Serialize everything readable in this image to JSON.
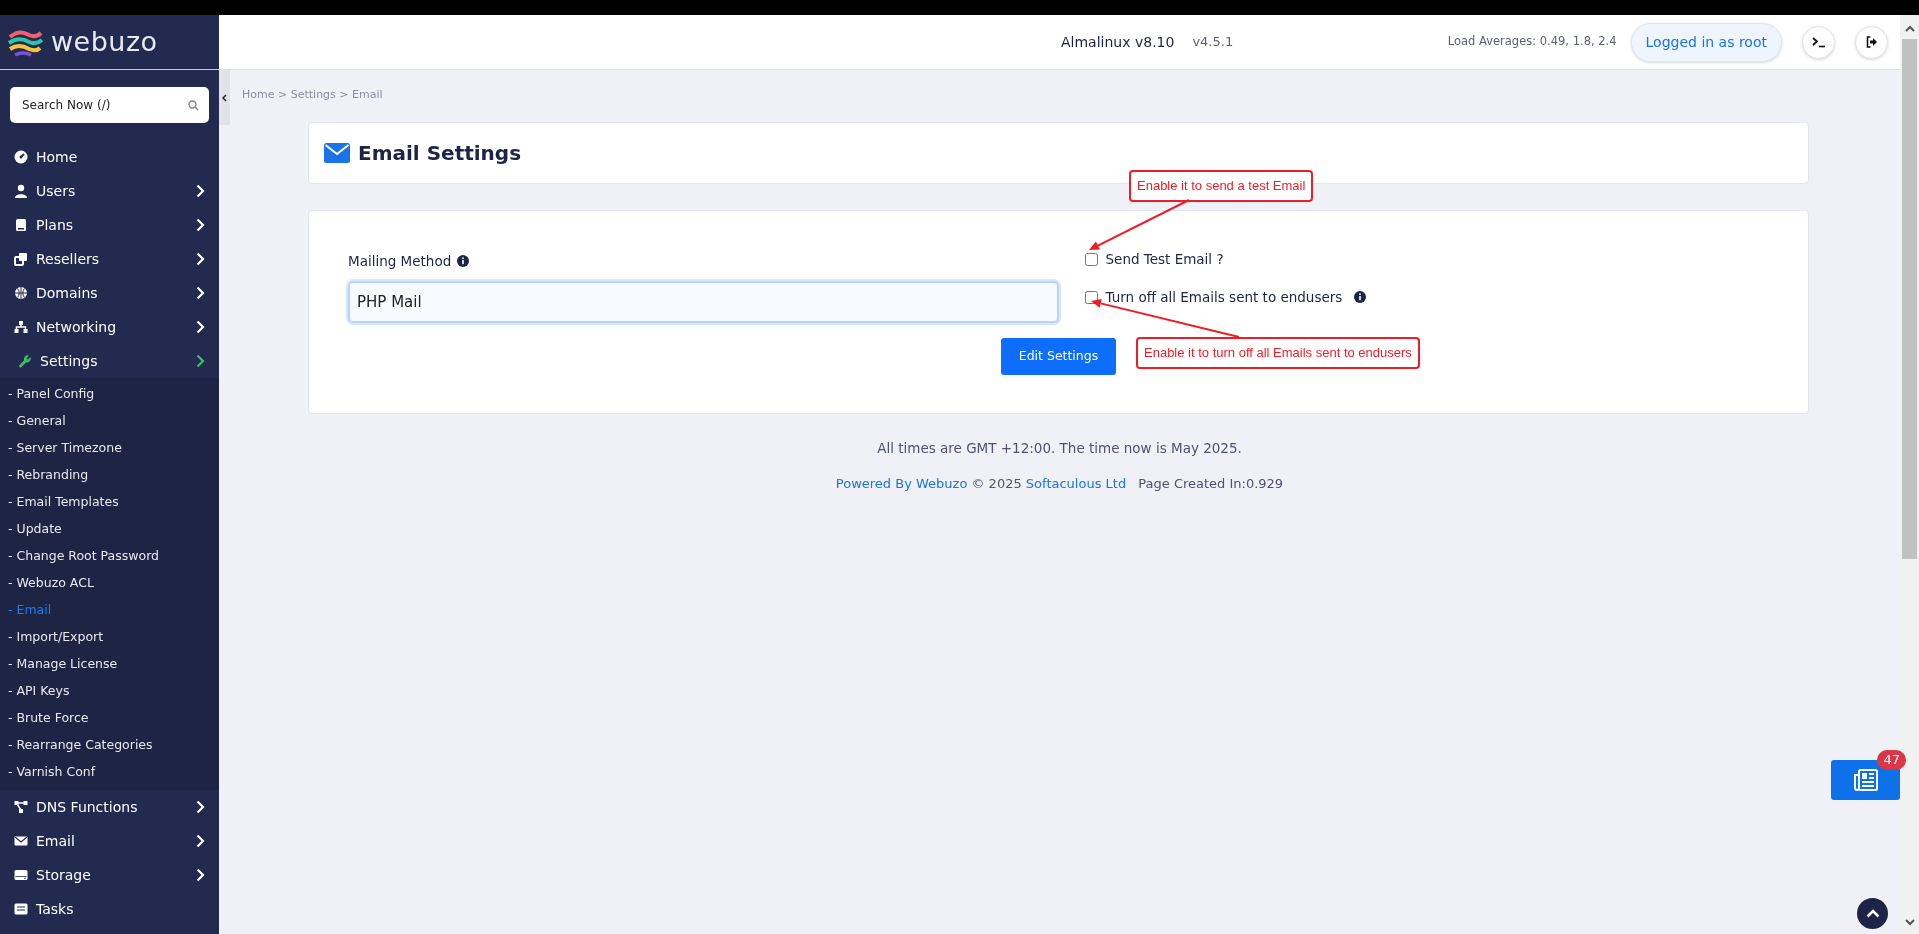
{
  "sidebar": {
    "logo": "webuzo",
    "search": {
      "placeholder": "Search Now (/)"
    },
    "items": [
      {
        "label": "Home",
        "has_submenu": false,
        "expanded": false
      },
      {
        "label": "Users",
        "has_submenu": true,
        "expanded": false
      },
      {
        "label": "Plans",
        "has_submenu": true,
        "expanded": false
      },
      {
        "label": "Resellers",
        "has_submenu": true,
        "expanded": false
      },
      {
        "label": "Domains",
        "has_submenu": true,
        "expanded": false
      },
      {
        "label": "Networking",
        "has_submenu": true,
        "expanded": false
      },
      {
        "label": "Settings",
        "has_submenu": true,
        "expanded": true,
        "children": [
          {
            "label": "- Panel Config",
            "selected": false
          },
          {
            "label": "- General",
            "selected": false
          },
          {
            "label": "- Server Timezone",
            "selected": false
          },
          {
            "label": "- Rebranding",
            "selected": false
          },
          {
            "label": "- Email Templates",
            "selected": false
          },
          {
            "label": "- Update",
            "selected": false
          },
          {
            "label": "- Change Root Password",
            "selected": false
          },
          {
            "label": "- Webuzo ACL",
            "selected": false
          },
          {
            "label": "- Email",
            "selected": true
          },
          {
            "label": "- Import/Export",
            "selected": false
          },
          {
            "label": "- Manage License",
            "selected": false
          },
          {
            "label": "- API Keys",
            "selected": false
          },
          {
            "label": "- Brute Force",
            "selected": false
          },
          {
            "label": "- Rearrange Categories",
            "selected": false
          },
          {
            "label": "- Varnish Conf",
            "selected": false
          }
        ]
      },
      {
        "label": "DNS Functions",
        "has_submenu": true,
        "expanded": false
      },
      {
        "label": "Email",
        "has_submenu": true,
        "expanded": false
      },
      {
        "label": "Storage",
        "has_submenu": true,
        "expanded": false
      },
      {
        "label": "Tasks",
        "has_submenu": false,
        "expanded": false
      }
    ]
  },
  "topbar": {
    "os": "Almalinux v8.10",
    "version": "v4.5.1",
    "load_averages": "Load Averages: 0.49, 1.8, 2.4",
    "user_button": "Logged in as root"
  },
  "breadcrumb": {
    "items": [
      "Home",
      "Settings",
      "Email"
    ],
    "separator": ">"
  },
  "page_title": "Email Settings",
  "form": {
    "mailing_method": {
      "label": "Mailing Method",
      "value": "PHP Mail"
    },
    "options": [
      {
        "label": "Send Test Email ?",
        "checked": false,
        "info": false
      },
      {
        "label": "Turn off all Emails sent to endusers",
        "checked": false,
        "info": true
      }
    ],
    "submit": "Edit Settings"
  },
  "annotations": [
    {
      "text": "Enable it to send a test Email"
    },
    {
      "text": "Enable it to turn off all Emails sent to endusers"
    }
  ],
  "footer": {
    "time_note": "All times are GMT +12:00. The time now is May 2025.",
    "powered_by": "Powered By Webuzo",
    "copyright": "© 2025",
    "company": "Softaculous Ltd",
    "page_created": "Page Created In:0.929"
  },
  "news_badge": "47"
}
